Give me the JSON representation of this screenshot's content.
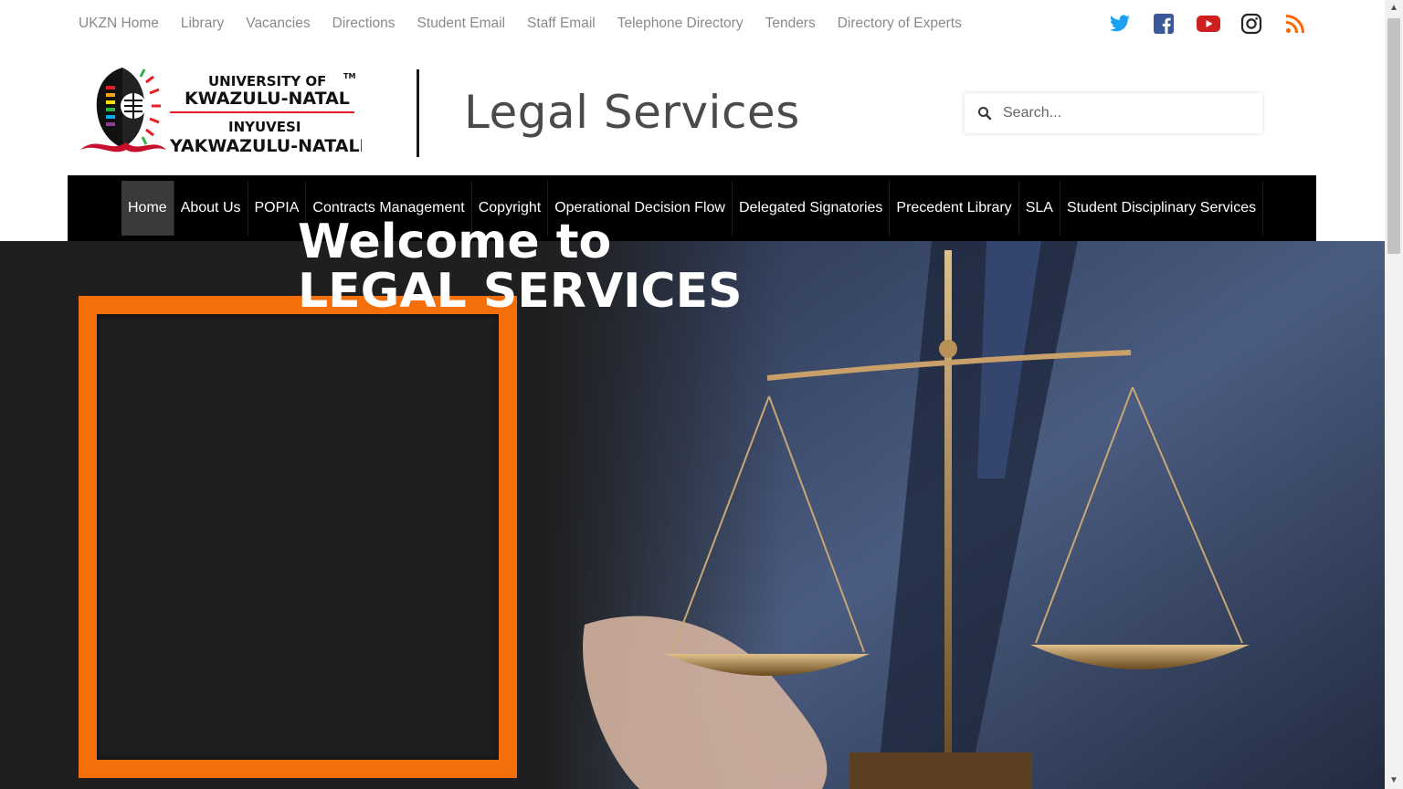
{
  "toplinks": [
    "UKZN Home",
    "Library",
    "Vacancies",
    "Directions",
    "Student Email",
    "Staff Email",
    "Telephone Directory",
    "Tenders",
    "Directory of Experts"
  ],
  "social": [
    {
      "name": "twitter-icon",
      "color": "#1da1f2"
    },
    {
      "name": "facebook-icon",
      "color": "#3b5998"
    },
    {
      "name": "youtube-icon",
      "color": "#cd201f"
    },
    {
      "name": "instagram-icon",
      "color": "#262626"
    },
    {
      "name": "rss-icon",
      "color": "#ff6600"
    }
  ],
  "logo": {
    "line1": "UNIVERSITY OF",
    "line2": "KWAZULU-NATAL",
    "line3": "INYUVESI",
    "line4": "YAKWAZULU-NATALI",
    "tm": "TM"
  },
  "header": {
    "title": "Legal Services"
  },
  "search": {
    "placeholder": "Search..."
  },
  "nav": {
    "items": [
      "Home",
      "About Us",
      "POPIA",
      "Contracts Management",
      "Copyright",
      "Operational Decision Flow",
      "Delegated Signatories",
      "Precedent Library",
      "SLA",
      "Student Disciplinary Services"
    ],
    "active": "Home"
  },
  "hero": {
    "line1": "Welcome to",
    "line2": "LEGAL SERVICES"
  },
  "colors": {
    "accent": "#f46f0a",
    "nav_bg": "#000000",
    "hero_bg": "#1f1f1f"
  }
}
